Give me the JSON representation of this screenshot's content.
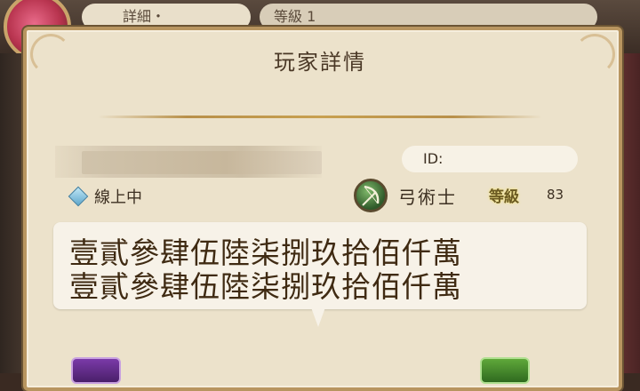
{
  "background": {
    "name_pill_text": "詳細・",
    "level_pill_text": "等級 1"
  },
  "dialog": {
    "title": "玩家詳情",
    "id_label": "ID:",
    "status_text": "線上中",
    "class_name": "弓術士",
    "level_label": "等級",
    "level_value": "83",
    "message_line_1": "壹貳參肆伍陸柒捌玖拾佰仟萬",
    "message_line_2": "壹貳參肆伍陸柒捌玖拾佰仟萬"
  },
  "colors": {
    "panel_bg": "#ece2cb",
    "panel_border": "#b89560",
    "text_dark": "#3d3022",
    "status_diamond": "#5fa7cc"
  },
  "icons": {
    "status": "online-diamond-icon",
    "class": "archer-bow-icon"
  }
}
